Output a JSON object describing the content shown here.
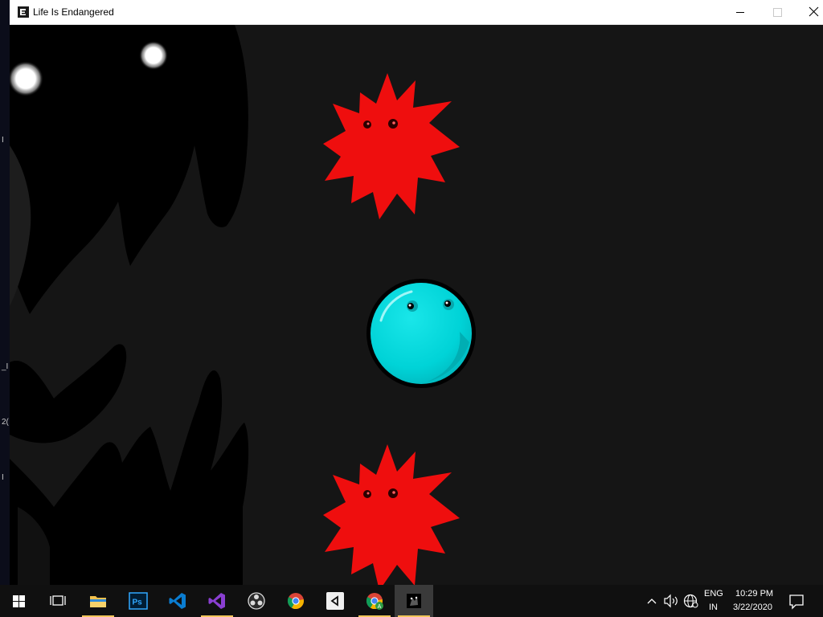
{
  "window": {
    "title": "Life Is Endangered"
  },
  "desktop_sliver": {
    "glyphs": [
      "I",
      "_I",
      "2(",
      "I"
    ]
  },
  "game": {
    "scene": "side-scroller",
    "player": {
      "type": "cyan-blob",
      "color": "#00d5d8"
    },
    "enemies": [
      {
        "type": "red-spiky-virus",
        "color": "#ef0e0e"
      },
      {
        "type": "red-spiky-virus",
        "color": "#ef0e0e"
      }
    ],
    "background_color": "#151515",
    "shadow_monster": {
      "eyes": 2,
      "eye_color": "#ffffff"
    }
  },
  "taskbar": {
    "apps": [
      {
        "name": "file-explorer",
        "active": true
      },
      {
        "name": "photoshop",
        "active": false
      },
      {
        "name": "vscode",
        "active": false
      },
      {
        "name": "visual-studio",
        "active": true
      },
      {
        "name": "obs",
        "active": false
      },
      {
        "name": "chrome",
        "active": false
      },
      {
        "name": "unity",
        "active": false
      },
      {
        "name": "chrome-profile",
        "active": true
      },
      {
        "name": "life-is-endangered",
        "active": true
      }
    ],
    "tray": {
      "lang_top": "ENG",
      "lang_bottom": "IN",
      "time": "10:29 PM",
      "date": "3/22/2020"
    }
  }
}
